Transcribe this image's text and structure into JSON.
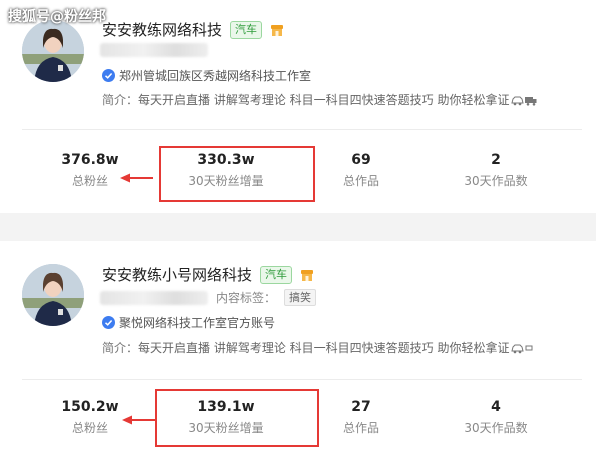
{
  "watermark": "搜狐号@粉丝邦",
  "colors": {
    "highlight": "#e53935",
    "verified": "#3d7cf0",
    "car_tag": "#2e9b3a",
    "shop_icon": "#f0a020"
  },
  "accounts": [
    {
      "name": "安安教练网络科技",
      "category_tag": "汽车",
      "shop_icon": "shop-icon",
      "verified_icon": "verified-check-icon",
      "verified_text": "郑州管城回族区秀越网络科技工作室",
      "intro_label": "简介：",
      "intro_text": "每天开启直播 讲解驾考理论 科目一科目四快速答题技巧 助你轻松拿证",
      "trailing_icon": "car-truck-icon",
      "content_tag_label": "",
      "content_tag_value": "",
      "stats": [
        {
          "value": "376.8w",
          "label": "总粉丝"
        },
        {
          "value": "330.3w",
          "label": "30天粉丝增量"
        },
        {
          "value": "69",
          "label": "总作品"
        },
        {
          "value": "2",
          "label": "30天作品数"
        }
      ]
    },
    {
      "name": "安安教练小号网络科技",
      "category_tag": "汽车",
      "shop_icon": "shop-icon",
      "verified_icon": "verified-check-icon",
      "verified_text": "聚悦网络科技工作室官方账号",
      "intro_label": "简介：",
      "intro_text": "每天开启直播 讲解驾考理论 科目一科目四快速答题技巧 助你轻松拿证",
      "trailing_icon": "car-icon",
      "content_tag_label": "内容标签：",
      "content_tag_value": "搞笑",
      "stats": [
        {
          "value": "150.2w",
          "label": "总粉丝"
        },
        {
          "value": "139.1w",
          "label": "30天粉丝增量"
        },
        {
          "value": "27",
          "label": "总作品"
        },
        {
          "value": "4",
          "label": "30天作品数"
        }
      ]
    }
  ]
}
